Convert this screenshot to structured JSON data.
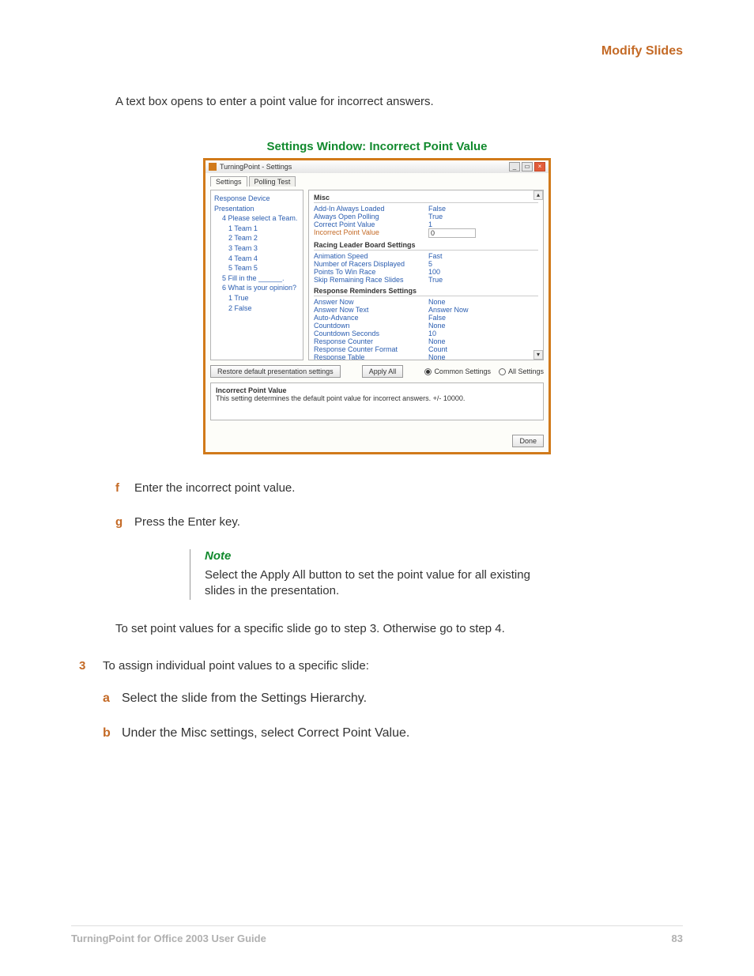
{
  "header": {
    "section": "Modify Slides"
  },
  "intro": "A text box opens to enter a point value for incorrect answers.",
  "caption": "Settings Window: Incorrect Point Value",
  "window": {
    "title": "TurningPoint - Settings",
    "tabs": [
      "Settings",
      "Polling Test"
    ],
    "tree": {
      "root1": "Response Device",
      "root2": "Presentation",
      "q4": "4  Please select a Team.",
      "q4_items": [
        "1  Team 1",
        "2  Team 2",
        "3  Team 3",
        "4  Team 4",
        "5  Team 5"
      ],
      "q5": "5  Fill in the ______.",
      "q6": "6  What is your opinion?",
      "q6_items": [
        "1  True",
        "2  False"
      ]
    },
    "misc": {
      "title": "Misc",
      "rows": [
        {
          "k": "Add-In Always Loaded",
          "v": "False"
        },
        {
          "k": "Always Open Polling",
          "v": "True"
        },
        {
          "k": "Correct Point Value",
          "v": "1"
        }
      ],
      "highlight": {
        "k": "Incorrect Point Value",
        "v": "0"
      }
    },
    "racing": {
      "title": "Racing Leader Board Settings",
      "rows": [
        {
          "k": "Animation Speed",
          "v": "Fast"
        },
        {
          "k": "Number of Racers Displayed",
          "v": "5"
        },
        {
          "k": "Points To Win Race",
          "v": "100"
        },
        {
          "k": "Skip Remaining Race Slides",
          "v": "True"
        }
      ]
    },
    "reminders": {
      "title": "Response Reminders Settings",
      "rows": [
        {
          "k": "Answer Now",
          "v": "None"
        },
        {
          "k": "Answer Now Text",
          "v": "Answer Now"
        },
        {
          "k": "Auto-Advance",
          "v": "False"
        },
        {
          "k": "Countdown",
          "v": "None"
        },
        {
          "k": "Countdown Seconds",
          "v": "10"
        },
        {
          "k": "Response Counter",
          "v": "None"
        },
        {
          "k": "Response Counter Format",
          "v": "Count"
        },
        {
          "k": "Response Table",
          "v": "None"
        }
      ]
    },
    "buttons": {
      "restore": "Restore default presentation settings",
      "apply_all": "Apply All",
      "done": "Done"
    },
    "radios": {
      "common": "Common Settings",
      "all": "All Settings"
    },
    "desc": {
      "title": "Incorrect Point Value",
      "text": "This setting determines the default point value for incorrect answers. +/- 10000."
    }
  },
  "steps": {
    "f": {
      "letter": "f",
      "text": "Enter the incorrect point value."
    },
    "g": {
      "letter": "g",
      "text": "Press the Enter key."
    }
  },
  "note": {
    "title": "Note",
    "text": "Select the Apply All button to set the point value for all existing slides in the presentation."
  },
  "after_note": "To set point values for a specific slide go to step 3. Otherwise go to step 4.",
  "step3": {
    "num": "3",
    "text": "To assign individual point values to a specific slide:",
    "a": {
      "letter": "a",
      "text": "Select the slide from the Settings Hierarchy."
    },
    "b": {
      "letter": "b",
      "text": "Under the Misc settings, select Correct Point Value."
    }
  },
  "footer": {
    "left": "TurningPoint for Office 2003 User Guide",
    "right": "83"
  }
}
